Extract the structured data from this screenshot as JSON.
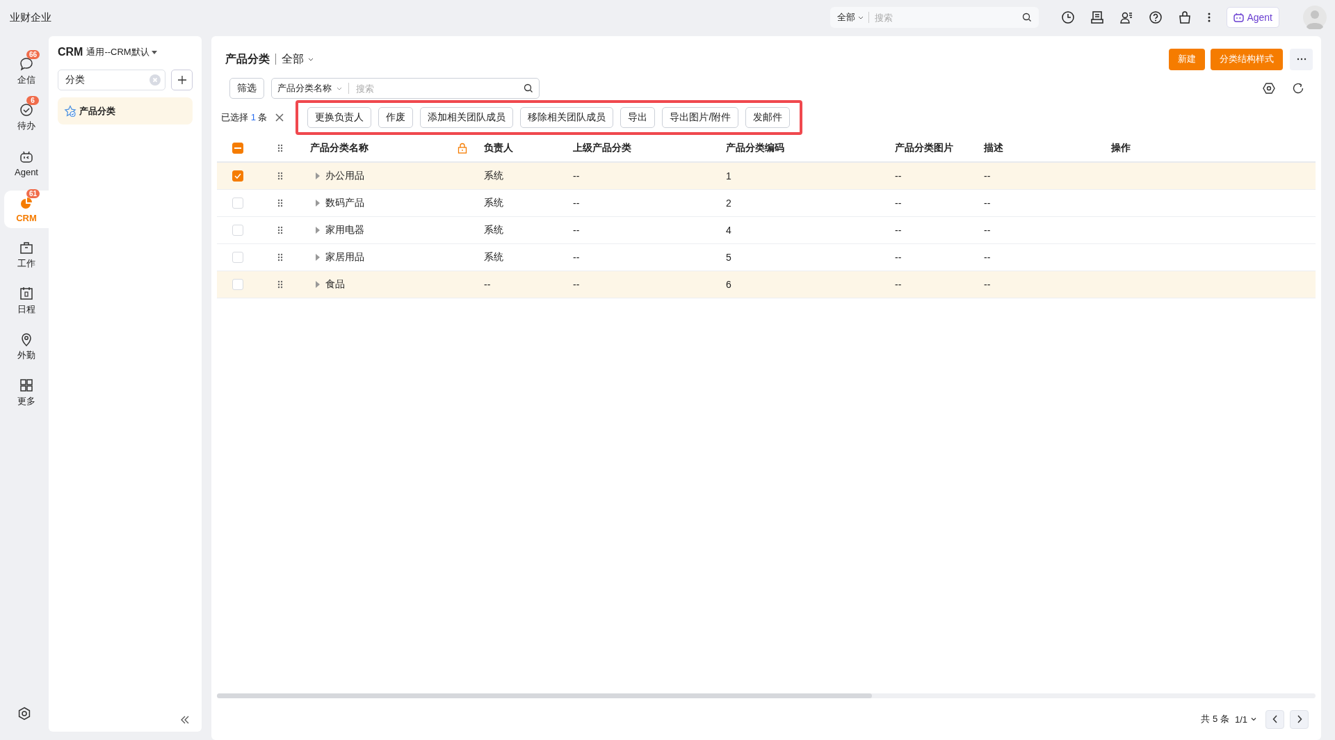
{
  "app_title": "业财企业",
  "topbar": {
    "scope": "全部",
    "search_placeholder": "搜索",
    "agent_button": "Agent"
  },
  "nav": [
    {
      "label": "企信",
      "badge": "66",
      "selected": false
    },
    {
      "label": "待办",
      "badge": "6",
      "selected": false
    },
    {
      "label": "Agent",
      "selected": false
    },
    {
      "label": "CRM",
      "badge": "61",
      "selected": true
    },
    {
      "label": "工作",
      "selected": false
    },
    {
      "label": "日程",
      "selected": false
    },
    {
      "label": "外勤",
      "selected": false
    },
    {
      "label": "更多",
      "selected": false
    }
  ],
  "sidebar": {
    "title": "CRM",
    "subtitle": "通用--CRM默认",
    "search_value": "分类",
    "items": [
      {
        "label": "产品分类",
        "selected": true
      }
    ]
  },
  "page": {
    "title": "产品分类",
    "scope": "全部",
    "buttons": [
      {
        "label": "新建",
        "kind": "primary"
      },
      {
        "label": "分类结构样式",
        "kind": "primary"
      }
    ],
    "filter_button": "筛选",
    "search_field": "产品分类名称",
    "search_placeholder": "搜索",
    "selection": {
      "prefix": "已选择",
      "count": "1",
      "suffix": "条"
    },
    "actions": [
      "更换负责人",
      "作废",
      "添加相关团队成员",
      "移除相关团队成员",
      "导出",
      "导出图片/附件",
      "发邮件"
    ],
    "actions_highlighted": true
  },
  "table": {
    "select_all": {
      "checked": true,
      "indeterminate": true
    },
    "columns": [
      "产品分类名称",
      "负责人",
      "上级产品分类",
      "产品分类编码",
      "产品分类图片",
      "描述",
      "操作"
    ],
    "rows": [
      {
        "cells": [
          "办公用品",
          "系统",
          "--",
          "1",
          "--",
          "--"
        ],
        "checked": true,
        "hovered": false
      },
      {
        "cells": [
          "数码产品",
          "系统",
          "--",
          "2",
          "--",
          "--"
        ],
        "checked": false,
        "hovered": false
      },
      {
        "cells": [
          "家用电器",
          "系统",
          "--",
          "4",
          "--",
          "--"
        ],
        "checked": false,
        "hovered": false
      },
      {
        "cells": [
          "家居用品",
          "系统",
          "--",
          "5",
          "--",
          "--"
        ],
        "checked": false,
        "hovered": false
      },
      {
        "cells": [
          "食品",
          "--",
          "--",
          "6",
          "--",
          "--"
        ],
        "checked": false,
        "hovered": true
      }
    ]
  },
  "footer": {
    "total": "共 5 条",
    "pages": "1/1"
  }
}
